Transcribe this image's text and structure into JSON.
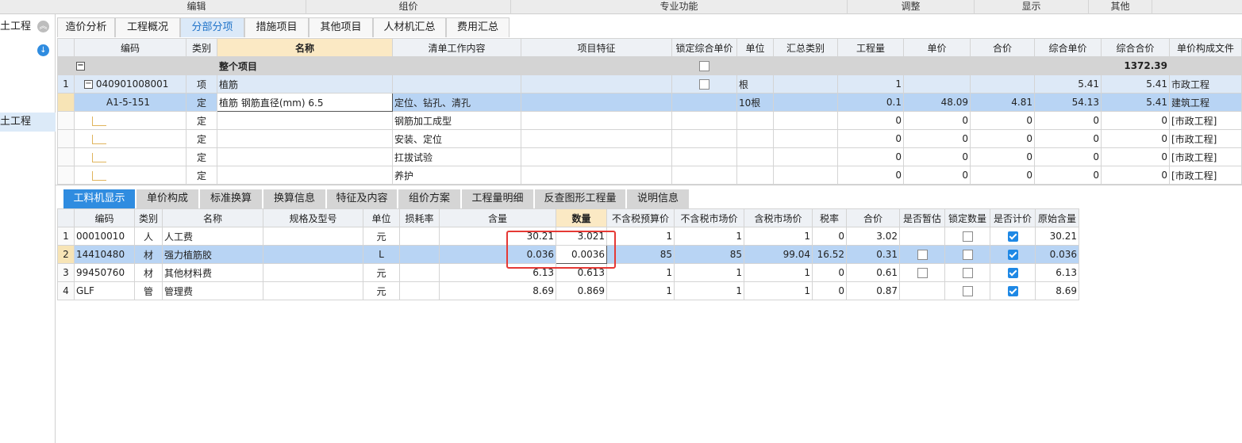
{
  "ribbon": {
    "edit": "编辑",
    "price": "组价",
    "special": "专业功能",
    "adjust": "调整",
    "display": "显示",
    "other": "其他"
  },
  "left_panel": {
    "item1": "土工程",
    "item2": "土工程"
  },
  "tabs": {
    "t1": "造价分析",
    "t2": "工程概况",
    "t3": "分部分项",
    "t4": "措施项目",
    "t5": "其他项目",
    "t6": "人材机汇总",
    "t7": "费用汇总"
  },
  "top_headers": {
    "h_code": "编码",
    "h_type": "类别",
    "h_name": "名称",
    "h_content": "清单工作内容",
    "h_feature": "项目特征",
    "h_lock": "锁定综合单价",
    "h_unit": "单位",
    "h_sumtype": "汇总类别",
    "h_qty": "工程量",
    "h_price": "单价",
    "h_total": "合价",
    "h_cprice": "综合单价",
    "h_ctotal": "综合合价",
    "h_file": "单价构成文件"
  },
  "top_group": {
    "name": "整个项目",
    "ctotal": "1372.39"
  },
  "top_r1": {
    "idx": "1",
    "code": "040901008001",
    "type": "项",
    "name": "植筋",
    "unit": "根",
    "qty": "1",
    "cprice": "5.41",
    "ctotal": "5.41",
    "file": "市政工程"
  },
  "top_r2": {
    "code": "A1-5-151",
    "type": "定",
    "name": "植筋 钢筋直径(mm) 6.5",
    "content": "定位、钻孔、清孔",
    "unit": "10根",
    "qty": "0.1",
    "price": "48.09",
    "total": "4.81",
    "cprice": "54.13",
    "ctotal": "5.41",
    "file": "建筑工程"
  },
  "top_r3": {
    "type": "定",
    "content": "钢筋加工成型",
    "qty": "0",
    "price": "0",
    "total": "0",
    "cprice": "0",
    "ctotal": "0",
    "file": "[市政工程]"
  },
  "top_r4": {
    "type": "定",
    "content": "安装、定位",
    "qty": "0",
    "price": "0",
    "total": "0",
    "cprice": "0",
    "ctotal": "0",
    "file": "[市政工程]"
  },
  "top_r5": {
    "type": "定",
    "content": "扛拔试验",
    "qty": "0",
    "price": "0",
    "total": "0",
    "cprice": "0",
    "ctotal": "0",
    "file": "[市政工程]"
  },
  "top_r6": {
    "type": "定",
    "content": "养护",
    "qty": "0",
    "price": "0",
    "total": "0",
    "cprice": "0",
    "ctotal": "0",
    "file": "[市政工程]"
  },
  "btabs": {
    "b1": "工料机显示",
    "b2": "单价构成",
    "b3": "标准换算",
    "b4": "换算信息",
    "b5": "特征及内容",
    "b6": "组价方案",
    "b7": "工程量明细",
    "b8": "反查图形工程量",
    "b9": "说明信息"
  },
  "bot_headers": {
    "code": "编码",
    "type": "类别",
    "name": "名称",
    "spec": "规格及型号",
    "unit": "单位",
    "loss": "损耗率",
    "content": "含量",
    "qty": "数量",
    "p1": "不含税预算价",
    "p2": "不含税市场价",
    "p3": "含税市场价",
    "tax": "税率",
    "total": "合价",
    "est": "是否暂估",
    "lock": "锁定数量",
    "calc": "是否计价",
    "orig": "原始含量"
  },
  "bot_r1": {
    "idx": "1",
    "code": "00010010",
    "type": "人",
    "name": "人工费",
    "unit": "元",
    "content": "30.21",
    "qty": "3.021",
    "p1": "1",
    "p2": "1",
    "p3": "1",
    "tax": "0",
    "total": "3.02",
    "orig": "30.21"
  },
  "bot_r2": {
    "idx": "2",
    "code": "14410480",
    "type": "材",
    "name": "强力植筋胶",
    "unit": "L",
    "content": "0.036",
    "qty": "0.0036",
    "p1": "85",
    "p2": "85",
    "p3": "99.04",
    "tax": "16.52",
    "total": "0.31",
    "orig": "0.036"
  },
  "bot_r3": {
    "idx": "3",
    "code": "99450760",
    "type": "材",
    "name": "其他材料费",
    "unit": "元",
    "content": "6.13",
    "qty": "0.613",
    "p1": "1",
    "p2": "1",
    "p3": "1",
    "tax": "0",
    "total": "0.61",
    "orig": "6.13"
  },
  "bot_r4": {
    "idx": "4",
    "code": "GLF",
    "type": "管",
    "name": "管理费",
    "unit": "元",
    "content": "8.69",
    "qty": "0.869",
    "p1": "1",
    "p2": "1",
    "p3": "1",
    "tax": "0",
    "total": "0.87",
    "orig": "8.69"
  }
}
